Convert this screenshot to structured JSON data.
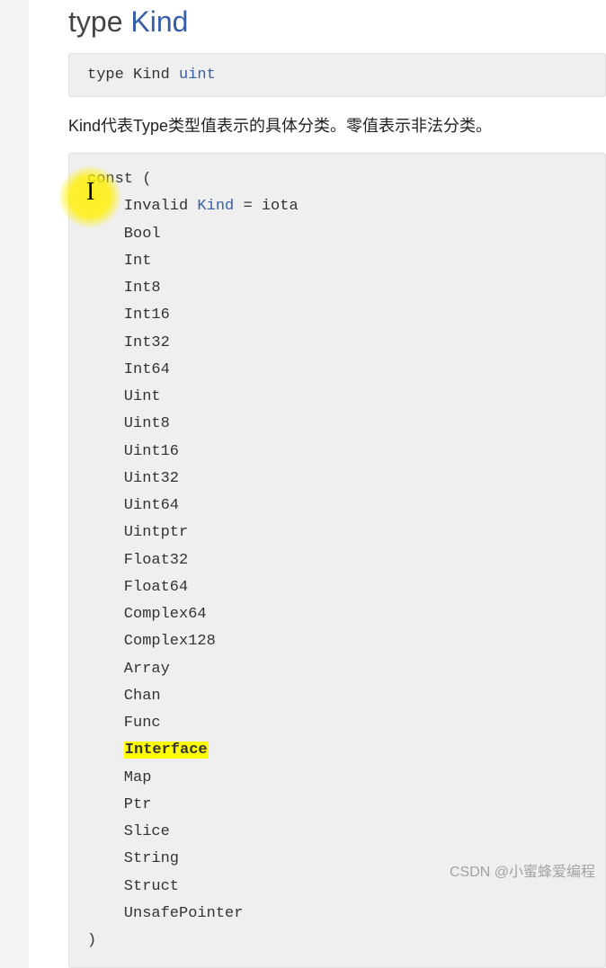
{
  "heading": {
    "keyword": "type",
    "name": "Kind"
  },
  "type_decl": {
    "keyword": "type",
    "name": "Kind",
    "base": "uint"
  },
  "description": "Kind代表Type类型值表示的具体分类。零值表示非法分类。",
  "const_block": {
    "open": "const (",
    "first_line": {
      "name": "Invalid",
      "type": "Kind",
      "eq": "=",
      "iota": "iota"
    },
    "items": [
      "Bool",
      "Int",
      "Int8",
      "Int16",
      "Int32",
      "Int64",
      "Uint",
      "Uint8",
      "Uint16",
      "Uint32",
      "Uint64",
      "Uintptr",
      "Float32",
      "Float64",
      "Complex64",
      "Complex128",
      "Array",
      "Chan",
      "Func",
      "Interface",
      "Map",
      "Ptr",
      "Slice",
      "String",
      "Struct",
      "UnsafePointer"
    ],
    "highlighted": "Interface",
    "close": ")"
  },
  "watermark": "CSDN @小蜜蜂爱编程"
}
